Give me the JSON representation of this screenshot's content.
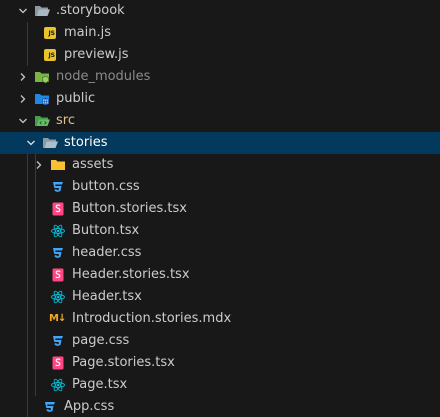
{
  "explorer": {
    "items": [
      {
        "label": ".storybook"
      },
      {
        "label": "main.js"
      },
      {
        "label": "preview.js"
      },
      {
        "label": "node_modules"
      },
      {
        "label": "public"
      },
      {
        "label": "src"
      },
      {
        "label": "stories"
      },
      {
        "label": "assets"
      },
      {
        "label": "button.css"
      },
      {
        "label": "Button.stories.tsx"
      },
      {
        "label": "Button.tsx"
      },
      {
        "label": "header.css"
      },
      {
        "label": "Header.stories.tsx"
      },
      {
        "label": "Header.tsx"
      },
      {
        "label": "Introduction.stories.mdx"
      },
      {
        "label": "page.css"
      },
      {
        "label": "Page.stories.tsx"
      },
      {
        "label": "Page.tsx"
      },
      {
        "label": "App.css"
      }
    ],
    "icon_badges": {
      "js": "JS",
      "mdx": "M↓"
    }
  },
  "colors": {
    "background": "#181818",
    "selected_row": "#04395e",
    "text": "#cccccc",
    "ignored_text": "#8b8b8b",
    "git_modified_text": "#e2c08d",
    "css_icon": "#42a5f5",
    "react_icon": "#00bcd4",
    "stories_icon": "#ff4785",
    "js_icon": "#e8c32b",
    "folder_yellow": "#f9c23c",
    "folder_green": "#7cb342",
    "folder_blue": "#42a5f5"
  }
}
